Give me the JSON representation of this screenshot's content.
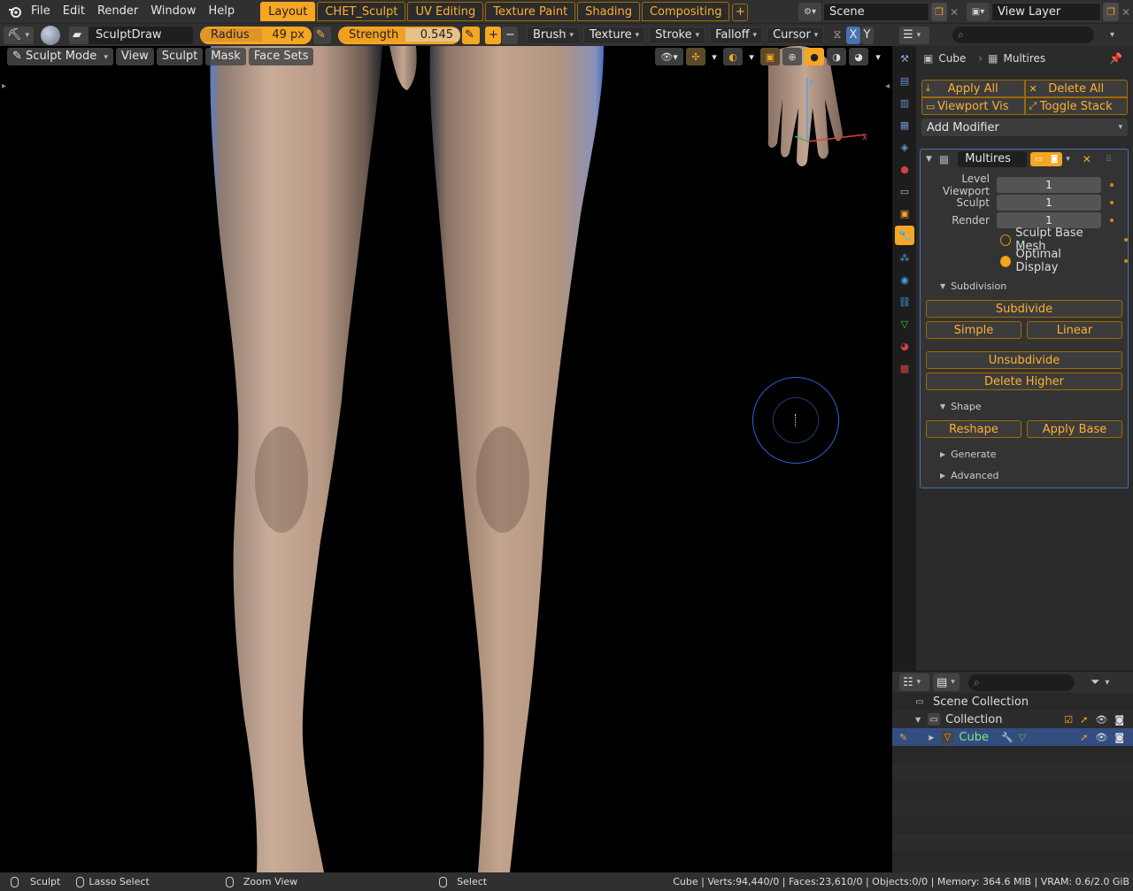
{
  "menu": {
    "items": [
      "File",
      "Edit",
      "Render",
      "Window",
      "Help"
    ]
  },
  "workspaces": {
    "tabs": [
      "Layout",
      "CHET_Sculpt",
      "UV Editing",
      "Texture Paint",
      "Shading",
      "Compositing"
    ],
    "add_label": "+"
  },
  "scene": {
    "name": "Scene"
  },
  "view_layer": {
    "name": "View Layer"
  },
  "toolbar": {
    "brush_name": "SculptDraw",
    "radius_label": "Radius",
    "radius_value": "49 px",
    "strength_label": "Strength",
    "strength_value": "0.545",
    "plus": "+",
    "minus": "−",
    "brush_menu": "Brush",
    "texture_menu": "Texture",
    "stroke_menu": "Stroke",
    "falloff_menu": "Falloff",
    "cursor_menu": "Cursor",
    "x_axis": "X",
    "y_axis": "Y"
  },
  "viewport": {
    "mode": "Sculpt Mode",
    "menus": [
      "View",
      "Sculpt",
      "Mask",
      "Face Sets"
    ],
    "axis_x": "x",
    "axis_z": "z"
  },
  "properties": {
    "object_name": "Cube",
    "modifier_crumb": "Multires",
    "apply_all": "Apply All",
    "delete_all": "Delete All",
    "viewport_vis": "Viewport Vis",
    "toggle_stack": "Toggle Stack",
    "add_modifier": "Add Modifier",
    "modifier": {
      "name": "Multires",
      "fields": [
        {
          "label": "Level Viewport",
          "value": "1"
        },
        {
          "label": "Sculpt",
          "value": "1"
        },
        {
          "label": "Render",
          "value": "1"
        }
      ],
      "sculpt_base_mesh": "Sculpt Base Mesh",
      "optimal_display": "Optimal Display",
      "subdivision_label": "Subdivision",
      "subdivide": "Subdivide",
      "simple": "Simple",
      "linear": "Linear",
      "unsubdivide": "Unsubdivide",
      "delete_higher": "Delete Higher",
      "shape_label": "Shape",
      "reshape": "Reshape",
      "apply_base": "Apply Base",
      "generate_label": "Generate",
      "advanced_label": "Advanced"
    }
  },
  "outliner": {
    "scene_collection": "Scene Collection",
    "collection": "Collection",
    "object": "Cube"
  },
  "statusbar": {
    "sculpt": "Sculpt",
    "lasso": "Lasso Select",
    "zoom": "Zoom View",
    "select": "Select",
    "stats": "Cube | Verts:94,440/0 | Faces:23,610/0 | Objects:0/0 | Memory: 364.6 MiB | VRAM: 0.6/2.0 GiB"
  },
  "colors": {
    "accent": "#f5a623",
    "selection": "#334d80",
    "brush_circle": "#2a66d6"
  }
}
